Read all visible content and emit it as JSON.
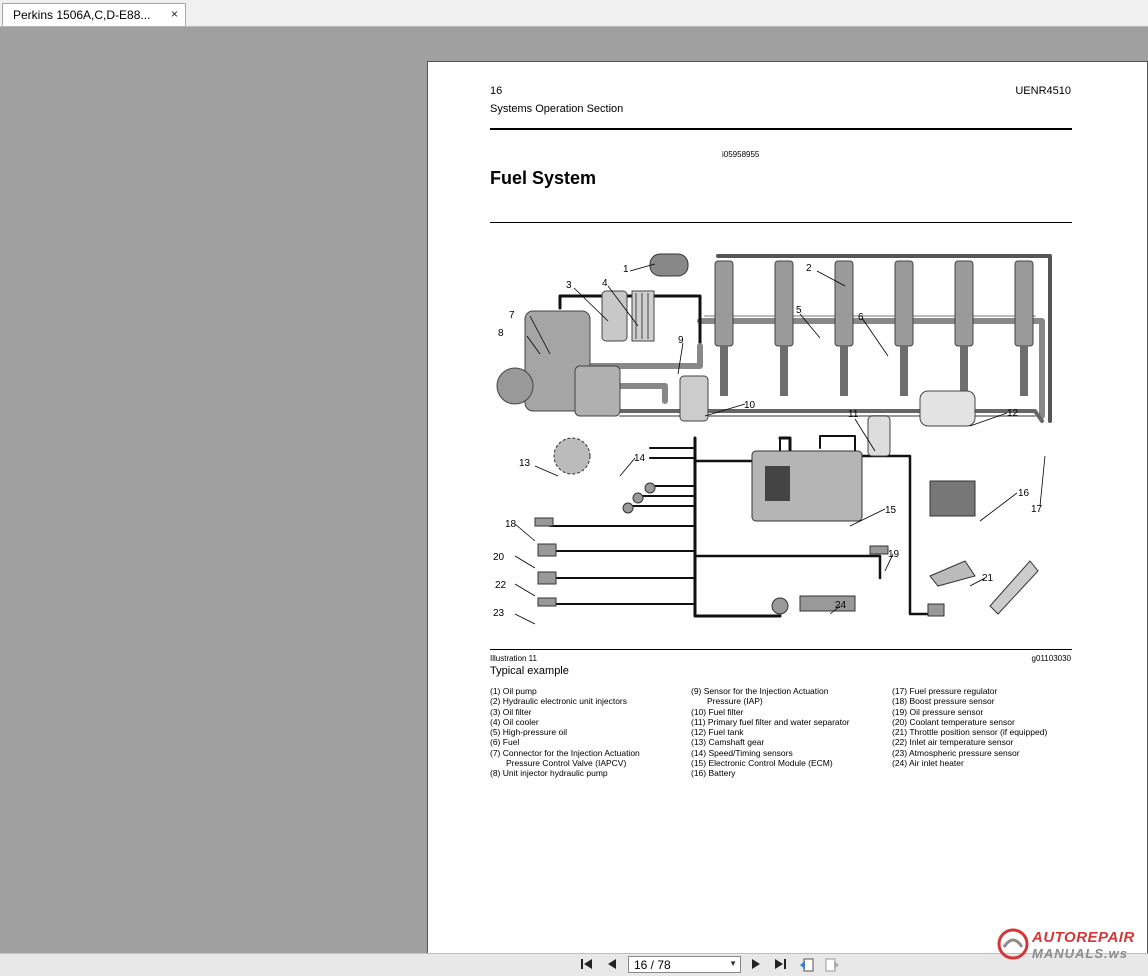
{
  "tab": {
    "title": "Perkins 1506A,C,D-E88...",
    "close": "×"
  },
  "page": {
    "number": "16",
    "doc_id": "UENR4510",
    "section": "Systems Operation Section",
    "figure_id": "i05958955",
    "title": "Fuel System",
    "illustration_label": "Illustration 11",
    "graphic_id": "g01103030",
    "caption": "Typical example"
  },
  "diagram": {
    "callouts": [
      "1",
      "2",
      "3",
      "4",
      "5",
      "6",
      "7",
      "8",
      "9",
      "10",
      "11",
      "12",
      "13",
      "14",
      "15",
      "16",
      "17",
      "18",
      "19",
      "20",
      "21",
      "22",
      "23",
      "24"
    ]
  },
  "legend": {
    "col1": [
      "(1) Oil pump",
      "(2) Hydraulic electronic unit injectors",
      "(3) Oil filter",
      "(4) Oil cooler",
      "(5) High-pressure oil",
      "(6) Fuel",
      "(7) Connector for the Injection Actuation",
      "Pressure Control Valve (IAPCV)",
      "(8) Unit injector hydraulic pump"
    ],
    "col2": [
      "(9) Sensor for the Injection Actuation",
      "Pressure (IAP)",
      "(10) Fuel filter",
      "(11) Primary fuel filter and water separator",
      "(12) Fuel tank",
      "(13) Camshaft gear",
      "(14) Speed/Timing sensors",
      "(15) Electronic Control Module (ECM)",
      "(16) Battery"
    ],
    "col3": [
      "(17) Fuel pressure regulator",
      "(18) Boost pressure sensor",
      "(19) Oil pressure sensor",
      "(20) Coolant temperature sensor",
      "(21) Throttle position sensor (if equipped)",
      "(22) Inlet air temperature sensor",
      "(23) Atmospheric pressure sensor",
      "(24) Air inlet heater"
    ]
  },
  "navigation": {
    "page_display": "16 / 78"
  },
  "watermark": {
    "line1": "AUTOREPAIR",
    "line2": "MANUALS.ws"
  }
}
